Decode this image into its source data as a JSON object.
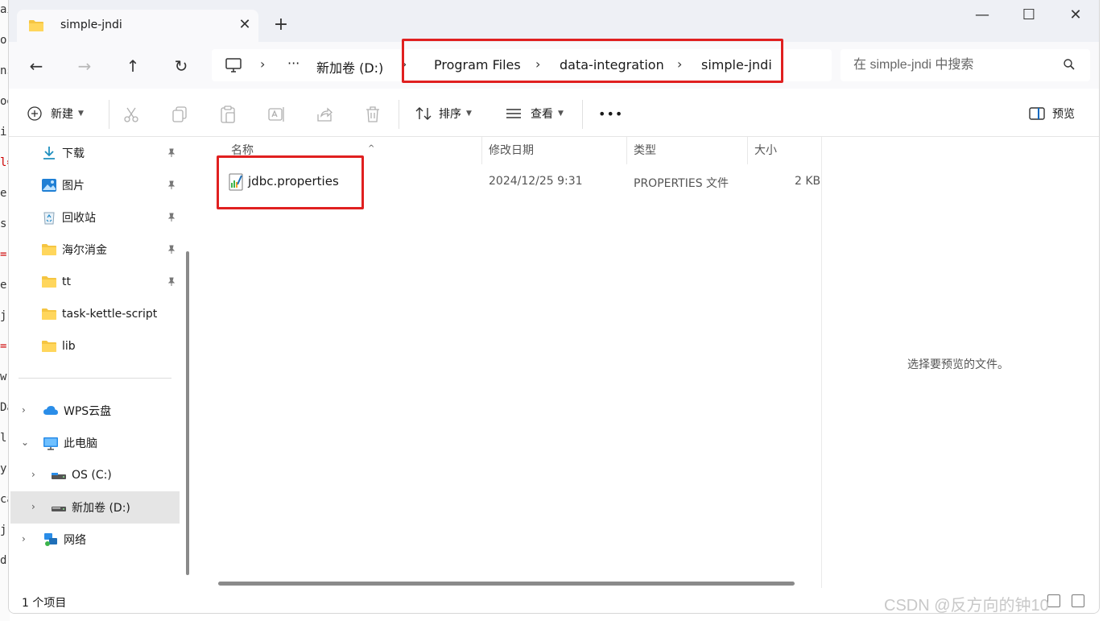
{
  "background_editor": {
    "lines": [
      "ai",
      "o",
      "ns",
      "oe",
      "i",
      "l=",
      "e",
      "s",
      "=",
      "e",
      "j",
      "=",
      "w",
      "Da",
      "l",
      "y",
      "ca",
      "j",
      "d"
    ]
  },
  "window": {
    "tab_title": "simple-jndi",
    "tab_close_label": "✕",
    "new_tab_label": "+",
    "minimize_label": "—",
    "maximize_label": "☐",
    "close_label": "✕"
  },
  "navigation": {
    "back_label": "←",
    "forward_label": "→",
    "up_label": "↑",
    "refresh_label": "↻",
    "ellipsis_label": "···",
    "breadcrumb": [
      "新加卷 (D:)",
      "Program Files",
      "data-integration",
      "simple-jndi"
    ],
    "search_placeholder": "在 simple-jndi 中搜索"
  },
  "toolbar": {
    "new_label": "新建",
    "sort_label": "排序",
    "view_label": "查看",
    "more_label": "•••",
    "preview_label": "预览"
  },
  "sidebar": {
    "quick_access": [
      {
        "label": "下载",
        "icon": "download-icon",
        "pinned": true
      },
      {
        "label": "图片",
        "icon": "pictures-icon",
        "pinned": true
      },
      {
        "label": "回收站",
        "icon": "recycle-bin-icon",
        "pinned": true
      },
      {
        "label": "海尔消金",
        "icon": "folder-icon",
        "pinned": true
      },
      {
        "label": "tt",
        "icon": "folder-icon",
        "pinned": true
      },
      {
        "label": "task-kettle-script",
        "icon": "folder-icon",
        "pinned": false
      },
      {
        "label": "lib",
        "icon": "folder-icon",
        "pinned": false
      }
    ],
    "tree": [
      {
        "label": "WPS云盘",
        "icon": "cloud-icon",
        "expanded": false
      },
      {
        "label": "此电脑",
        "icon": "computer-icon",
        "expanded": true
      },
      {
        "label": "OS (C:)",
        "icon": "drive-icon",
        "expanded": false
      },
      {
        "label": "新加卷 (D:)",
        "icon": "drive-icon",
        "expanded": false,
        "selected": true
      },
      {
        "label": "网络",
        "icon": "network-icon",
        "expanded": false
      }
    ]
  },
  "file_list": {
    "columns": [
      "名称",
      "修改日期",
      "类型",
      "大小"
    ],
    "rows": [
      {
        "name": "jdbc.properties",
        "modified": "2024/12/25 9:31",
        "type": "PROPERTIES 文件",
        "size": "2 KB"
      }
    ]
  },
  "preview": {
    "message": "选择要预览的文件。"
  },
  "status": {
    "item_count": "1 个项目"
  },
  "watermark": "CSDN @反方向的钟10",
  "colors": {
    "highlight": "#e02020",
    "folder": "#f5c542",
    "accent": "#0067c0",
    "selected_bg": "#e5e5e5"
  }
}
